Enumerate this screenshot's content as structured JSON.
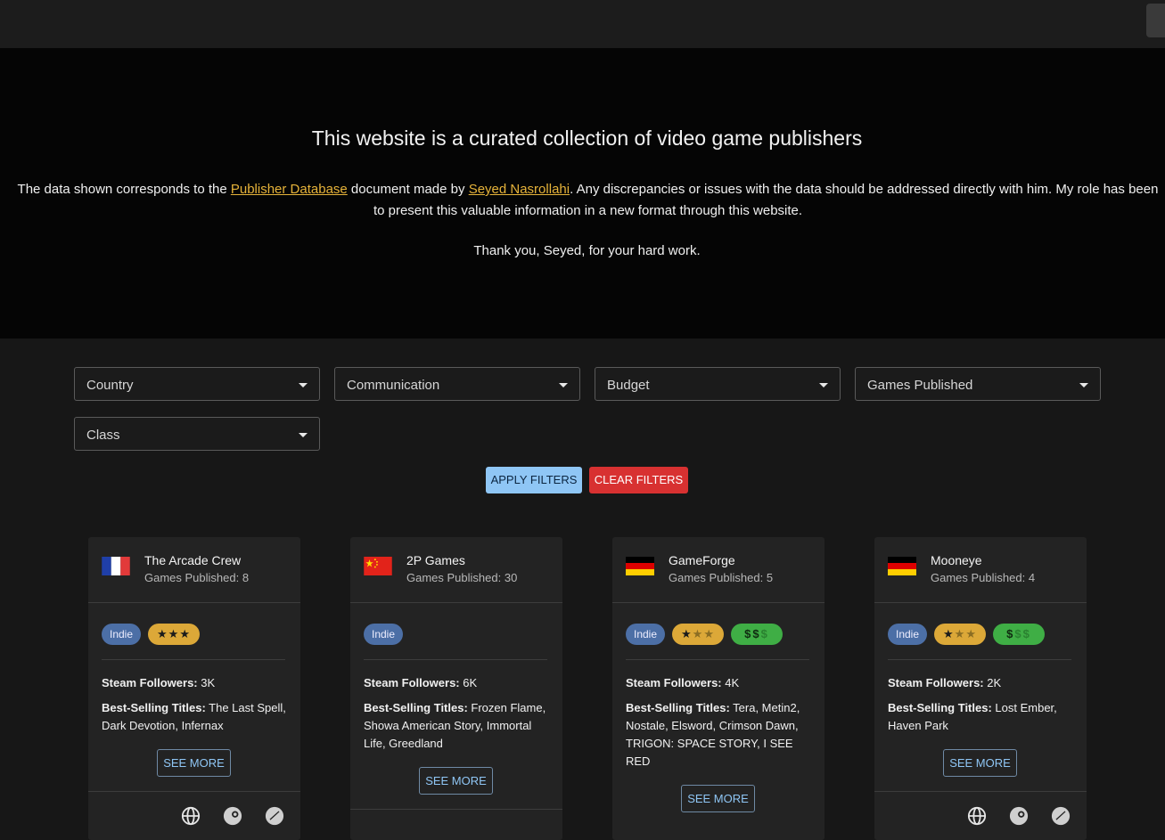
{
  "hero": {
    "title": "This website is a curated collection of video game publishers",
    "text_prefix": "The data shown corresponds to the ",
    "link_database": "Publisher Database",
    "text_middle": " document made by ",
    "link_author": "Seyed Nasrollahi",
    "text_suffix": ". Any discrepancies or issues with the data should be addressed directly with him. My role has been to present this valuable information in a new format through this website.",
    "thanks": "Thank you, Seyed, for your hard work."
  },
  "filters": {
    "country": "Country",
    "communication": "Communication",
    "budget": "Budget",
    "games_published": "Games Published",
    "class": "Class",
    "apply_label": "APPLY FILTERS",
    "clear_label": "CLEAR FILTERS"
  },
  "labels": {
    "steam_followers": "Steam Followers:",
    "best_selling": "Best-Selling Titles:",
    "see_more": "SEE MORE",
    "indie": "Indie"
  },
  "cards": [
    {
      "name": "The Arcade Crew",
      "games": "Games Published: 8",
      "flag": "france-flag",
      "stars": 3,
      "money": 0,
      "steam": " 3K",
      "titles": " The Last Spell, Dark Devotion, Infernax"
    },
    {
      "name": "2P Games",
      "games": "Games Published: 30",
      "flag": "china-flag",
      "stars": 0,
      "money": 0,
      "steam": " 6K",
      "titles": " Frozen Flame, Showa American Story, Immortal Life, Greedland"
    },
    {
      "name": "GameForge",
      "games": "Games Published: 5",
      "flag": "germany-flag",
      "stars": 1,
      "money": 2,
      "steam": " 4K",
      "titles": " Tera, Metin2, Nostale, Elsword, Crimson Dawn, TRIGON: SPACE STORY, I SEE RED"
    },
    {
      "name": "Mooneye",
      "games": "Games Published: 4",
      "flag": "germany-flag",
      "stars": 1,
      "money": 1,
      "steam": " 2K",
      "titles": " Lost Ember, Haven Park"
    }
  ],
  "colors": {
    "accent_link": "#e6b33a",
    "apply_bg": "#8fc6f5",
    "clear_bg": "#d83131",
    "indie_badge": "#4c6fa6",
    "stars_badge": "#dca838",
    "money_badge": "#3fae45"
  }
}
